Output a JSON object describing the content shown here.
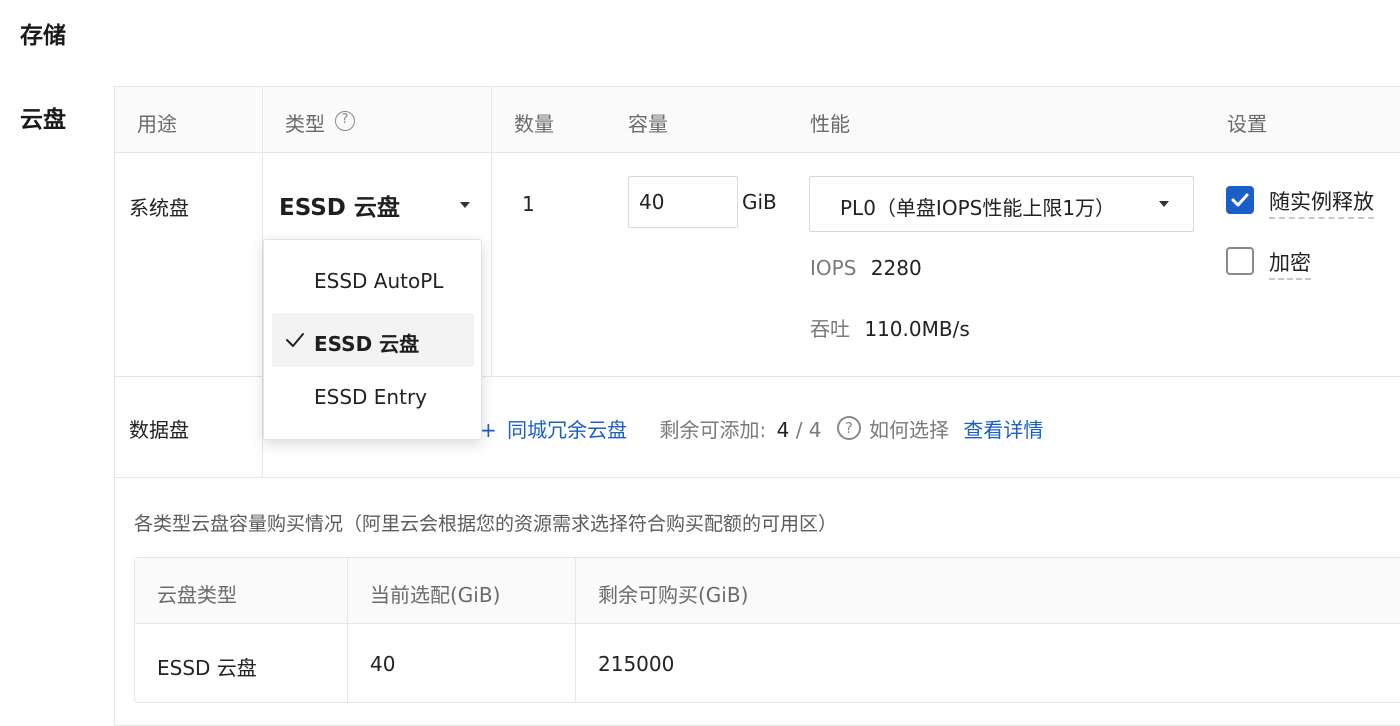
{
  "sections": {
    "storage": "存储",
    "cloud_disk": "云盘"
  },
  "table_headers": {
    "usage": "用途",
    "type": "类型",
    "quantity": "数量",
    "capacity": "容量",
    "performance": "性能",
    "settings": "设置"
  },
  "system_disk": {
    "usage": "系统盘",
    "type_selected": "ESSD 云盘",
    "quantity": "1",
    "capacity_value": "40",
    "capacity_unit": "GiB",
    "performance_selected": "PL0（单盘IOPS性能上限1万）",
    "iops_label": "IOPS",
    "iops_value": "2280",
    "throughput_label": "吞吐",
    "throughput_value": "110.0MB/s",
    "release_with_instance": {
      "label": "随实例释放",
      "checked": true
    },
    "encrypt": {
      "label": "加密",
      "checked": false
    }
  },
  "type_dropdown": {
    "options": [
      "ESSD AutoPL",
      "ESSD 云盘",
      "ESSD Entry"
    ],
    "selected_index": 1
  },
  "data_disk": {
    "usage": "数据盘",
    "add_redundant_link": "同城冗余云盘",
    "remaining_label": "剩余可添加:",
    "remaining_current": "4",
    "remaining_separator": "/",
    "remaining_total": "4",
    "how_to_choose": "如何选择",
    "view_details": "查看详情"
  },
  "capacity_purchase": {
    "title": "各类型云盘容量购买情况（阿里云会根据您的资源需求选择符合购买配额的可用区）",
    "headers": [
      "云盘类型",
      "当前选配(GiB)",
      "剩余可购买(GiB)"
    ],
    "rows": [
      [
        "ESSD 云盘",
        "40",
        "215000"
      ]
    ]
  },
  "colors": {
    "accent": "#1a5fc8",
    "checkbox_checked": "#1a5fc8",
    "border": "#e6e6e6",
    "header_bg": "#fafafa"
  },
  "icons": {
    "help": "question-circle-icon",
    "check": "checkmark-icon",
    "dropdown": "caret-down-icon"
  }
}
